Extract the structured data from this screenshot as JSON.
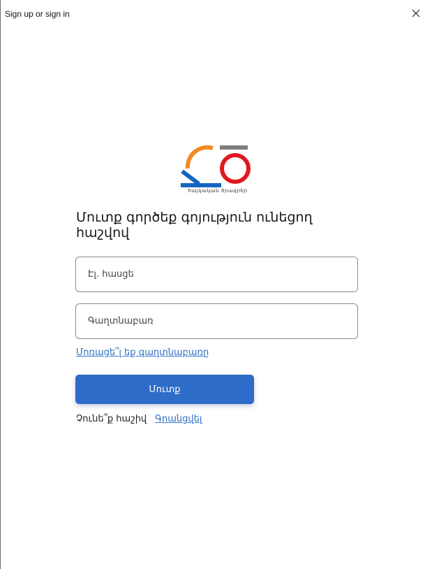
{
  "window": {
    "title": "Sign up or sign in",
    "close_symbol": "✕"
  },
  "logo": {
    "caption": "հայկական ծրագրեր",
    "colors": {
      "orange": "#f08a24",
      "blue": "#1565c0",
      "gray": "#7d7d7d",
      "red": "#e0191e"
    }
  },
  "form": {
    "heading": "Մուտք գործեք գոյություն ունեցող հաշվով",
    "email_placeholder": "Էլ. հասցե",
    "password_placeholder": "Գաղտնաբառ",
    "forgot_password": "Մոռացե՞լ եք գաղտնաբառը",
    "signin_label": "Մուտք",
    "no_account_text": "Չունե՞ք հաշիվ",
    "signup_link": "Գրանցվել"
  },
  "colors": {
    "accent": "#2d6cc8",
    "link": "#2d6fc4"
  }
}
